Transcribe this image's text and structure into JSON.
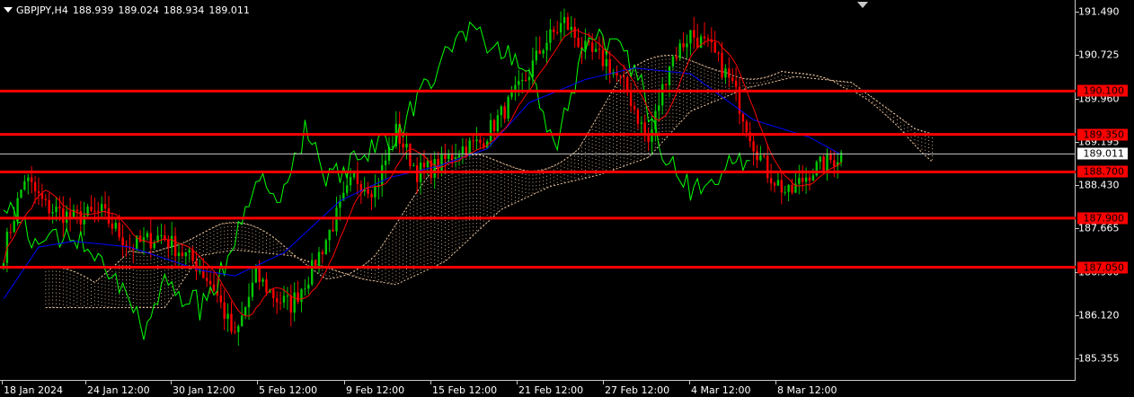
{
  "header": {
    "symbol": "GBPJPY,H4",
    "open": "188.939",
    "high": "189.024",
    "low": "188.934",
    "close": "189.011"
  },
  "price_axis": {
    "ticks": [
      "191.490",
      "190.725",
      "189.960",
      "189.195",
      "188.430",
      "187.665",
      "186.900",
      "186.120",
      "185.355"
    ]
  },
  "time_axis": {
    "labels": [
      "18 Jan 2024",
      "24 Jan 12:00",
      "30 Jan 12:00",
      "5 Feb 12:00",
      "9 Feb 12:00",
      "15 Feb 12:00",
      "21 Feb 12:00",
      "27 Feb 12:00",
      "4 Mar 12:00",
      "8 Mar 12:00"
    ]
  },
  "horizontal_levels": [
    {
      "label": "190.100",
      "price": 190.1
    },
    {
      "label": "189.350",
      "price": 189.35
    },
    {
      "label": "188.700",
      "price": 188.7
    },
    {
      "label": "187.900",
      "price": 187.9
    },
    {
      "label": "187.050",
      "price": 187.05
    }
  ],
  "current_price": {
    "label": "189.011",
    "price": 189.011
  },
  "colors": {
    "background": "#000000",
    "bull_candle": "#00c800",
    "bear_candle": "#ff0000",
    "tenkan": "#ff0000",
    "kijun": "#0000ff",
    "chikou": "#00ff00",
    "cloud": "#f0c8a0",
    "levels": "#ff0000",
    "axis_text": "#ffffff"
  },
  "chart_data": {
    "type": "candlestick",
    "symbol": "GBPJPY",
    "timeframe": "H4",
    "indicator": "Ichimoku Kinko Hyo",
    "ylim": [
      185.2,
      191.65
    ],
    "x_range": [
      "18 Jan 2024",
      "10 Mar 12:00"
    ],
    "price_path": [
      [
        0,
        187.3
      ],
      [
        6,
        188.6
      ],
      [
        12,
        188.1
      ],
      [
        20,
        187.9
      ],
      [
        28,
        188.0
      ],
      [
        36,
        187.4
      ],
      [
        45,
        187.6
      ],
      [
        55,
        187.1
      ],
      [
        60,
        186.7
      ],
      [
        66,
        185.8
      ],
      [
        72,
        186.9
      ],
      [
        78,
        186.5
      ],
      [
        82,
        186.4
      ],
      [
        88,
        187.0
      ],
      [
        94,
        187.8
      ],
      [
        100,
        188.6
      ],
      [
        106,
        188.4
      ],
      [
        112,
        189.4
      ],
      [
        118,
        188.7
      ],
      [
        124,
        188.8
      ],
      [
        130,
        189.1
      ],
      [
        136,
        189.2
      ],
      [
        142,
        189.7
      ],
      [
        148,
        190.2
      ],
      [
        154,
        190.9
      ],
      [
        160,
        191.3
      ],
      [
        166,
        190.8
      ],
      [
        172,
        190.6
      ],
      [
        178,
        190.1
      ],
      [
        184,
        189.2
      ],
      [
        190,
        190.6
      ],
      [
        196,
        191.1
      ],
      [
        202,
        190.8
      ],
      [
        208,
        190.2
      ],
      [
        214,
        189.2
      ],
      [
        218,
        188.7
      ],
      [
        224,
        188.3
      ],
      [
        230,
        188.7
      ],
      [
        236,
        188.9
      ],
      [
        239,
        189.0
      ]
    ],
    "kijun_path": [
      [
        0,
        186.5
      ],
      [
        10,
        187.4
      ],
      [
        20,
        187.5
      ],
      [
        36,
        187.4
      ],
      [
        56,
        187.0
      ],
      [
        66,
        186.9
      ],
      [
        80,
        187.3
      ],
      [
        96,
        188.2
      ],
      [
        110,
        188.6
      ],
      [
        124,
        188.8
      ],
      [
        138,
        189.1
      ],
      [
        150,
        189.9
      ],
      [
        166,
        190.3
      ],
      [
        180,
        190.5
      ],
      [
        196,
        190.4
      ],
      [
        214,
        189.6
      ],
      [
        230,
        189.3
      ],
      [
        239,
        189.0
      ]
    ]
  }
}
